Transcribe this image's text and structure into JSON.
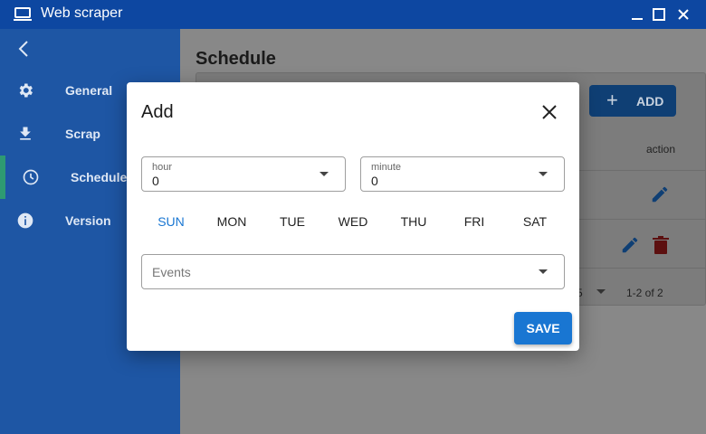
{
  "window": {
    "title": "Web scraper"
  },
  "sidebar": {
    "items": [
      {
        "label": "General",
        "icon": "gear-icon"
      },
      {
        "label": "Scrap",
        "icon": "download-icon"
      },
      {
        "label": "Schedule",
        "icon": "clock-icon"
      },
      {
        "label": "Version",
        "icon": "info-icon"
      }
    ],
    "active": "Schedule"
  },
  "main": {
    "title": "Schedule",
    "add_label": "ADD",
    "action_header": "action",
    "page_size": "5",
    "range": "1-2 of 2"
  },
  "dialog": {
    "title": "Add",
    "hour": {
      "label": "hour",
      "value": "0"
    },
    "minute": {
      "label": "minute",
      "value": "0"
    },
    "days": [
      "SUN",
      "MON",
      "TUE",
      "WED",
      "THU",
      "FRI",
      "SAT"
    ],
    "selected_day": "SUN",
    "events_placeholder": "Events",
    "save_label": "SAVE"
  },
  "colors": {
    "titlebar": "#0d47a1",
    "sidebar": "#1e56a4",
    "accent": "#1976d2",
    "delete": "#b71c1c"
  }
}
